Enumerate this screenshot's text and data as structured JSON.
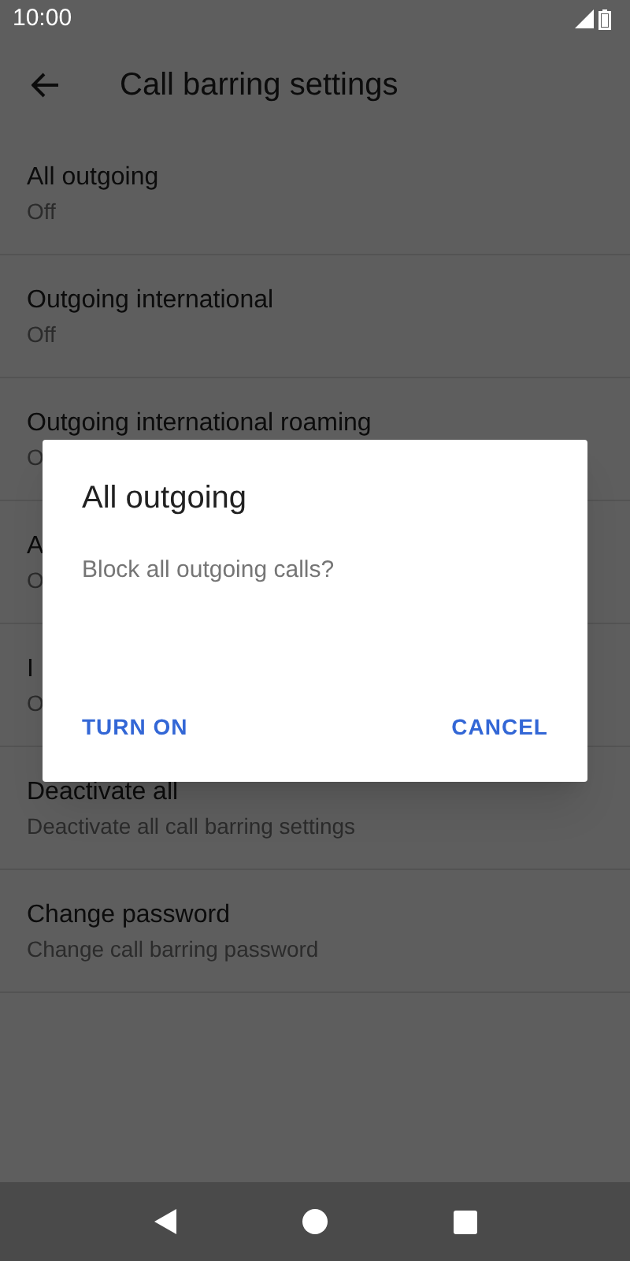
{
  "status_bar": {
    "time": "10:00"
  },
  "toolbar": {
    "title": "Call barring settings"
  },
  "settings": [
    {
      "title": "All outgoing",
      "summary": "Off"
    },
    {
      "title": "Outgoing international",
      "summary": "Off"
    },
    {
      "title": "Outgoing international roaming",
      "summary": "O"
    },
    {
      "title": "A",
      "summary": "O"
    },
    {
      "title": "I",
      "summary": "O"
    },
    {
      "title": "Deactivate all",
      "summary": "Deactivate all call barring settings"
    },
    {
      "title": "Change password",
      "summary": "Change call barring password"
    }
  ],
  "dialog": {
    "title": "All outgoing",
    "message": "Block all outgoing calls?",
    "buttons": [
      "TURN ON",
      "CANCEL"
    ]
  }
}
